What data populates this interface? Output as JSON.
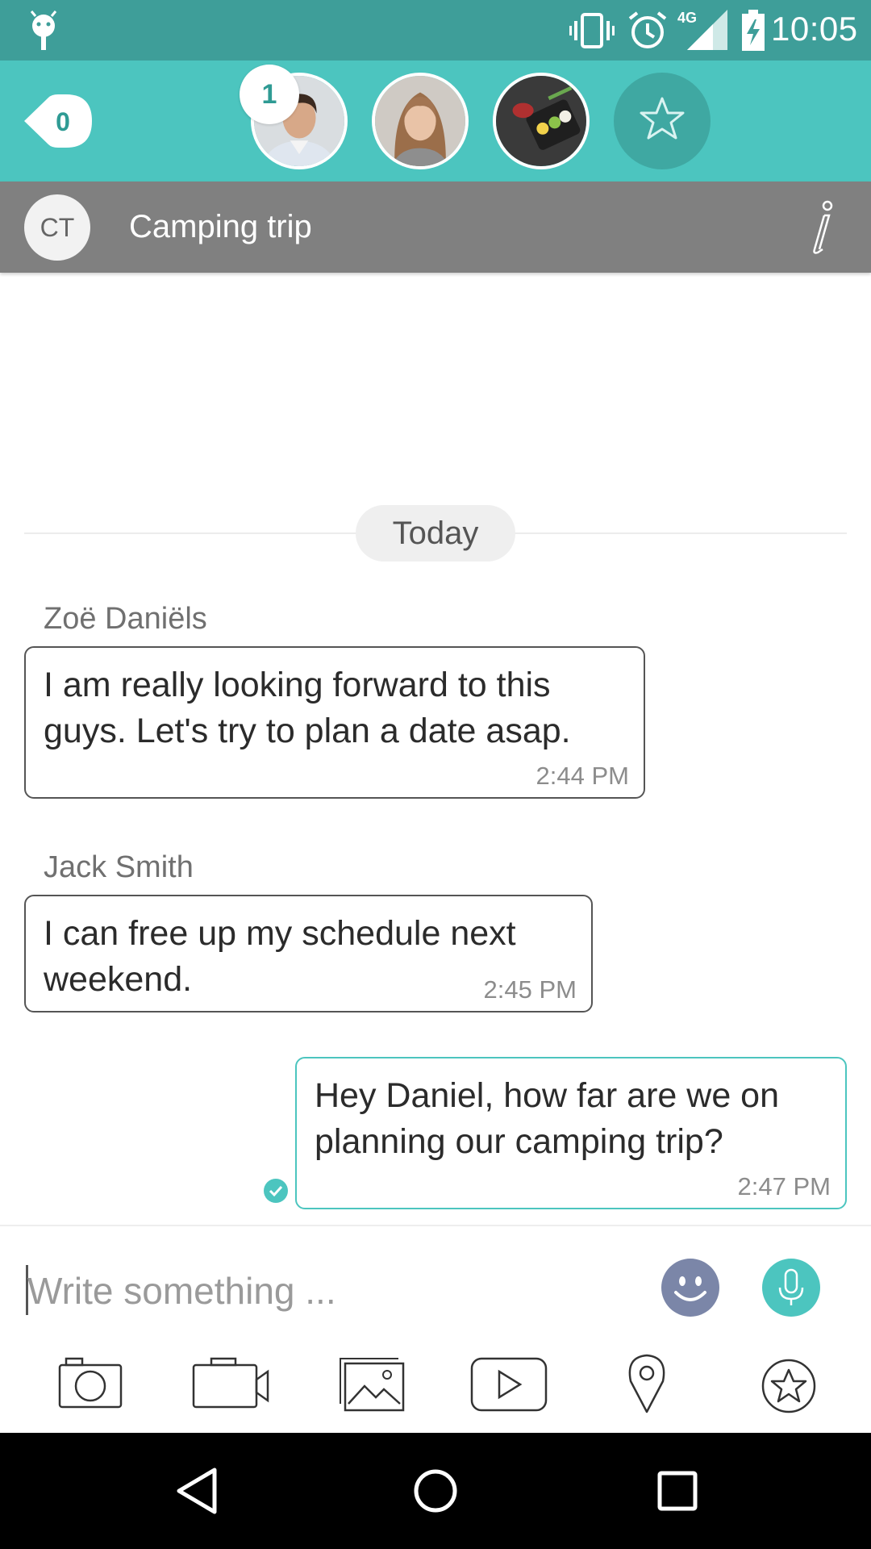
{
  "status_bar": {
    "time": "10:05",
    "network": "4G",
    "icons": [
      "android-icon",
      "vibrate-icon",
      "alarm-icon",
      "signal-icon",
      "battery-charging-icon"
    ]
  },
  "contacts": {
    "unread_count": "0",
    "badge_count": "1",
    "avatars": [
      "man-portrait",
      "woman-portrait",
      "food-plate"
    ],
    "favorites_icon": "star-icon"
  },
  "group": {
    "initials": "CT",
    "title": "Camping trip",
    "info_icon": "info-icon"
  },
  "date_divider": "Today",
  "messages": [
    {
      "sender": "Zoë Daniëls",
      "lines": [
        "I am really looking forward to this",
        "guys. Let's try to plan a date asap."
      ],
      "time": "2:44 PM",
      "direction": "in"
    },
    {
      "sender": "Jack Smith",
      "lines": [
        "I can free up my schedule next",
        "weekend."
      ],
      "time": "2:45 PM",
      "direction": "in"
    },
    {
      "sender": "",
      "lines": [
        "Hey Daniel, how far are we on",
        "planning our camping trip?"
      ],
      "time": "2:47 PM",
      "direction": "out"
    }
  ],
  "composer": {
    "placeholder": "Write something ...",
    "value": ""
  },
  "attachments": [
    "camera-icon",
    "video-camera-icon",
    "gallery-icon",
    "youtube-icon",
    "location-pin-icon",
    "star-icon"
  ],
  "colors": {
    "status_bar": "#3e9e99",
    "accent": "#4cc5bf",
    "group_header": "#808080",
    "emoji_button": "#7b86a8"
  }
}
